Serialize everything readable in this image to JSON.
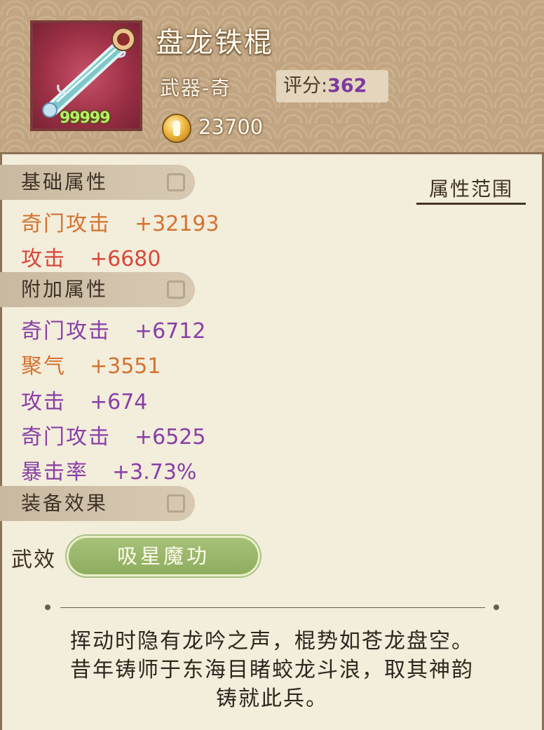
{
  "item": {
    "name": "盘龙铁棍",
    "type": "武器-奇",
    "score_label": "评分:",
    "score_value": "362",
    "level": "99999",
    "price": "23700",
    "icon": "iron-staff-icon",
    "frame_color": "#9a2f44"
  },
  "sections": {
    "base_title": "基础属性",
    "extra_title": "附加属性",
    "equip_title": "装备效果",
    "attr_range_label": "属性范围"
  },
  "base_attrs": [
    {
      "name": "奇门攻击",
      "value": "+32193",
      "color": "#d37331"
    },
    {
      "name": "攻击",
      "value": "+6680",
      "color": "#d8473a"
    }
  ],
  "extra_attrs": [
    {
      "name": "奇门攻击",
      "value": "+6712",
      "color": "#883fa6"
    },
    {
      "name": "聚气",
      "value": "+3551",
      "color": "#d37331"
    },
    {
      "name": "攻击",
      "value": "+674",
      "color": "#883fa6"
    },
    {
      "name": "奇门攻击",
      "value": "+6525",
      "color": "#883fa6"
    },
    {
      "name": "暴击率",
      "value": "+3.73%",
      "color": "#883fa6"
    }
  ],
  "equip_effect": {
    "label": "武效",
    "skill": "吸星魔功"
  },
  "description": [
    "挥动时隐有龙吟之声，棍势如苍龙盘空。",
    "昔年铸师于东海目睹蛟龙斗浪，取其神韵",
    "铸就此兵。"
  ]
}
